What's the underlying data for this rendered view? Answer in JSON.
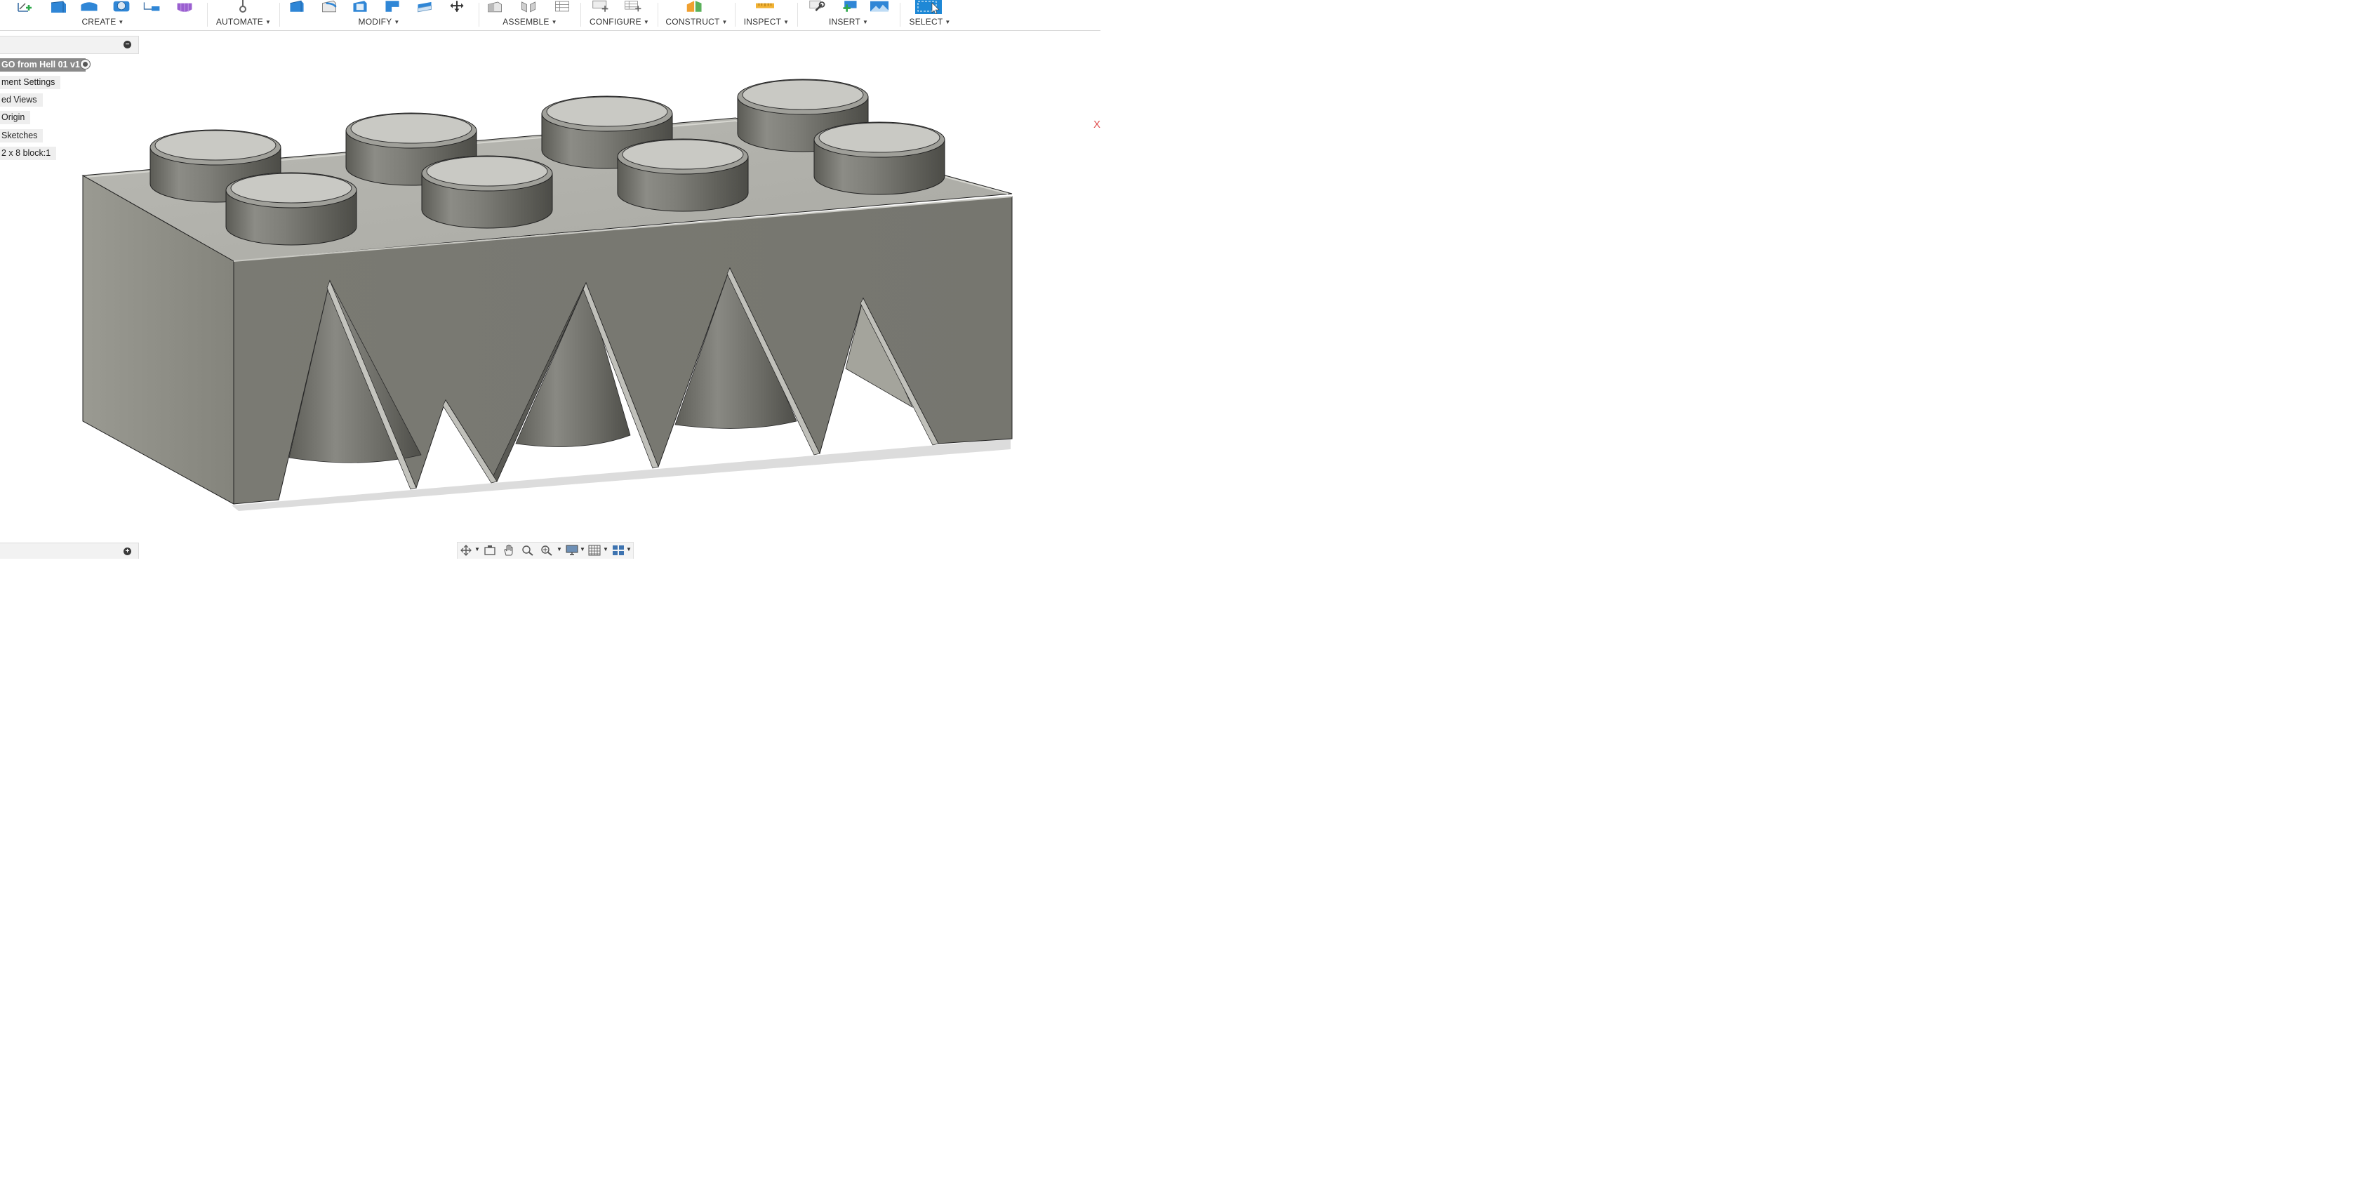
{
  "toolbar": {
    "groups": [
      {
        "label": "CREATE"
      },
      {
        "label": "AUTOMATE"
      },
      {
        "label": "MODIFY"
      },
      {
        "label": "ASSEMBLE"
      },
      {
        "label": "CONFIGURE"
      },
      {
        "label": "CONSTRUCT"
      },
      {
        "label": "INSPECT"
      },
      {
        "label": "INSERT"
      },
      {
        "label": "SELECT"
      }
    ],
    "caret": "▼"
  },
  "browser": {
    "items": [
      {
        "label": "GO from Hell 01 v1"
      },
      {
        "label": "ment Settings"
      },
      {
        "label": "ed Views"
      },
      {
        "label": "Origin"
      },
      {
        "label": "Sketches"
      },
      {
        "label": "2 x 8 block:1"
      }
    ],
    "collapse_symbol": "−",
    "expand_symbol": "+"
  },
  "viewcube": {
    "x_axis_label": "X"
  },
  "colors": {
    "accent_blue": "#1e88d6",
    "model_gray": "#7a7a72",
    "active_component": "#8a8a8a"
  },
  "icons": {
    "create": [
      "sketch-icon",
      "extrude-icon",
      "revolve-icon",
      "hole-icon",
      "pattern-icon",
      "form-icon"
    ],
    "automate": [
      "automate-icon"
    ],
    "modify": [
      "press-pull-icon",
      "fillet-icon",
      "shell-icon",
      "combine-icon",
      "offset-face-icon",
      "move-icon"
    ],
    "assemble": [
      "new-component-icon",
      "joint-icon",
      "table-icon"
    ],
    "configure": [
      "configure-icon",
      "configure-table-icon"
    ],
    "construct": [
      "plane-icon"
    ],
    "inspect": [
      "measure-icon"
    ],
    "insert": [
      "link-icon",
      "insert-derive-icon",
      "image-icon"
    ],
    "select": [
      "select-icon"
    ],
    "navbar": [
      "orbit-icon",
      "look-at-icon",
      "pan-icon",
      "zoom-icon",
      "zoom-window-icon",
      "display-icon",
      "grid-icon",
      "viewports-icon"
    ]
  }
}
